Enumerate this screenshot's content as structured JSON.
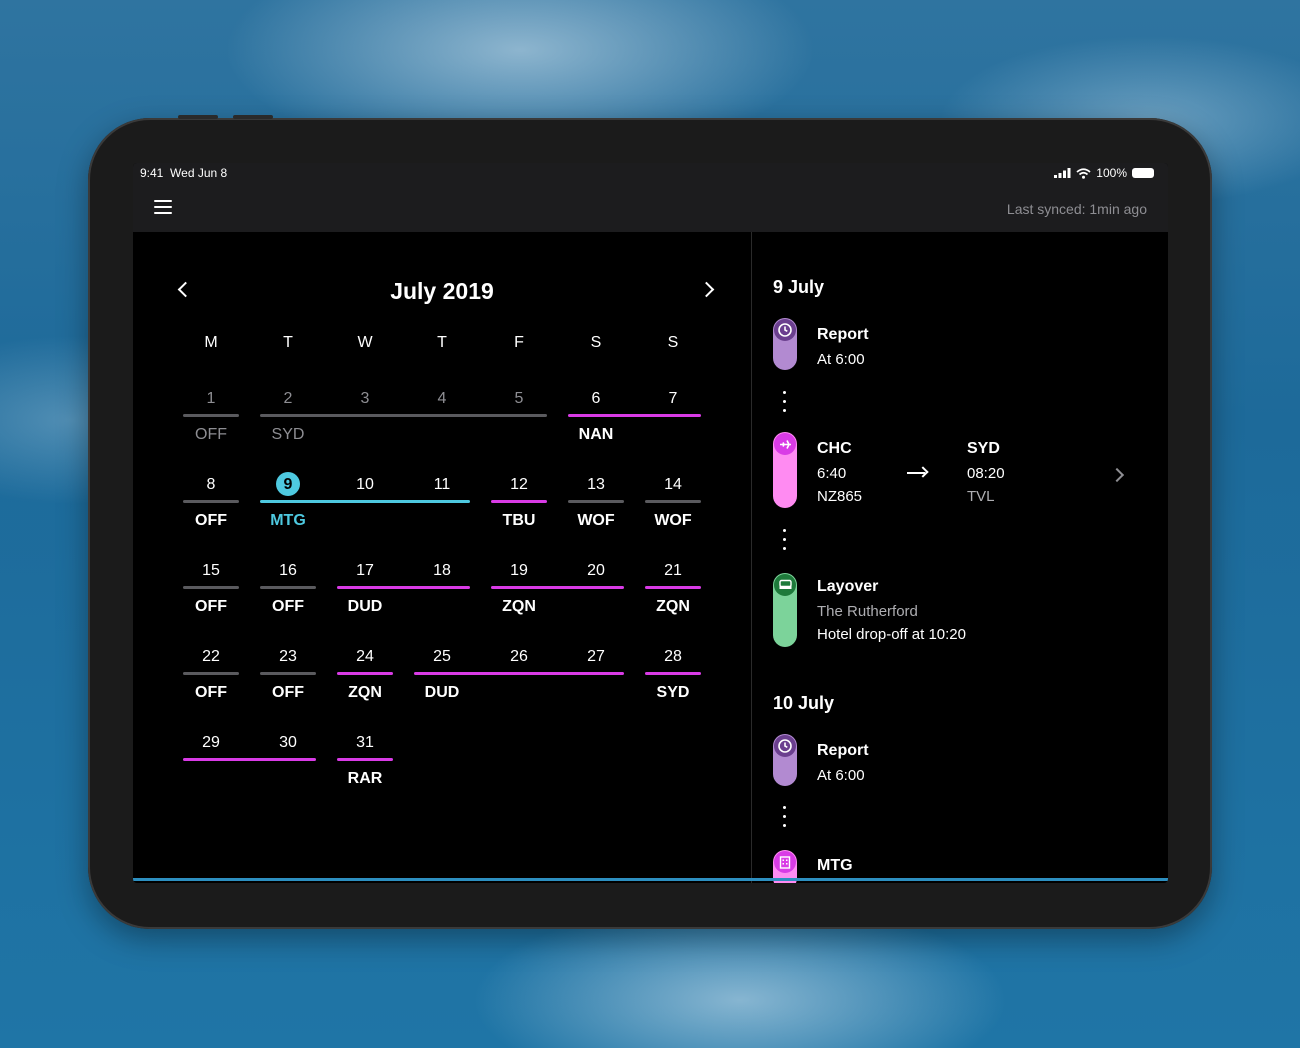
{
  "status_bar": {
    "time": "9:41",
    "date": "Wed Jun 8",
    "battery": "100%"
  },
  "app_bar": {
    "last_synced": "Last synced: 1min ago"
  },
  "colors": {
    "accent_purple": "#d93be6",
    "accent_cyan": "#4ec9e0",
    "neutral_bar": "#5a5a5e",
    "report": "#b28ad1",
    "flight": "#ff8bf2",
    "layover": "#7cd39a"
  },
  "calendar": {
    "month_title": "July 2019",
    "weekdays": [
      "M",
      "T",
      "W",
      "T",
      "F",
      "S",
      "S"
    ],
    "weeks": [
      {
        "days": [
          {
            "n": "1",
            "muted": true,
            "code": "OFF"
          },
          {
            "n": "2",
            "muted": true,
            "code": "SYD"
          },
          {
            "n": "3",
            "muted": true,
            "code": ""
          },
          {
            "n": "4",
            "muted": true,
            "code": ""
          },
          {
            "n": "5",
            "muted": true,
            "code": ""
          },
          {
            "n": "6",
            "code": "NAN"
          },
          {
            "n": "7",
            "code": ""
          }
        ],
        "bars": [
          {
            "from": 0,
            "to": 0,
            "color": "neutral_bar"
          },
          {
            "from": 1,
            "to": 4,
            "color": "neutral_bar"
          },
          {
            "from": 5,
            "to": 6,
            "color": "accent_purple"
          }
        ]
      },
      {
        "days": [
          {
            "n": "8",
            "code": "OFF"
          },
          {
            "n": "9",
            "code": "MTG",
            "today": true
          },
          {
            "n": "10",
            "code": ""
          },
          {
            "n": "11",
            "code": ""
          },
          {
            "n": "12",
            "code": "TBU"
          },
          {
            "n": "13",
            "code": "WOF"
          },
          {
            "n": "14",
            "code": "WOF"
          }
        ],
        "bars": [
          {
            "from": 0,
            "to": 0,
            "color": "neutral_bar"
          },
          {
            "from": 1,
            "to": 3,
            "color": "accent_cyan"
          },
          {
            "from": 4,
            "to": 4,
            "color": "accent_purple"
          },
          {
            "from": 5,
            "to": 5,
            "color": "neutral_bar"
          },
          {
            "from": 6,
            "to": 6,
            "color": "neutral_bar"
          }
        ]
      },
      {
        "days": [
          {
            "n": "15",
            "code": "OFF"
          },
          {
            "n": "16",
            "code": "OFF"
          },
          {
            "n": "17",
            "code": "DUD"
          },
          {
            "n": "18",
            "code": ""
          },
          {
            "n": "19",
            "code": "ZQN"
          },
          {
            "n": "20",
            "code": ""
          },
          {
            "n": "21",
            "code": "ZQN"
          }
        ],
        "bars": [
          {
            "from": 0,
            "to": 0,
            "color": "neutral_bar"
          },
          {
            "from": 1,
            "to": 1,
            "color": "neutral_bar"
          },
          {
            "from": 2,
            "to": 3,
            "color": "accent_purple"
          },
          {
            "from": 4,
            "to": 5,
            "color": "accent_purple"
          },
          {
            "from": 6,
            "to": 6,
            "color": "accent_purple"
          }
        ]
      },
      {
        "days": [
          {
            "n": "22",
            "code": "OFF"
          },
          {
            "n": "23",
            "code": "OFF"
          },
          {
            "n": "24",
            "code": "ZQN"
          },
          {
            "n": "25",
            "code": "DUD"
          },
          {
            "n": "26",
            "code": ""
          },
          {
            "n": "27",
            "code": ""
          },
          {
            "n": "28",
            "code": "SYD"
          }
        ],
        "bars": [
          {
            "from": 0,
            "to": 0,
            "color": "neutral_bar"
          },
          {
            "from": 1,
            "to": 1,
            "color": "neutral_bar"
          },
          {
            "from": 2,
            "to": 2,
            "color": "accent_purple"
          },
          {
            "from": 3,
            "to": 5,
            "color": "accent_purple"
          },
          {
            "from": 6,
            "to": 6,
            "color": "accent_purple"
          }
        ]
      },
      {
        "days": [
          {
            "n": "29",
            "code": ""
          },
          {
            "n": "30",
            "code": ""
          },
          {
            "n": "31",
            "code": "RAR"
          }
        ],
        "bars": [
          {
            "from": 0,
            "to": 1,
            "color": "accent_purple"
          },
          {
            "from": 2,
            "to": 2,
            "color": "accent_purple"
          }
        ]
      }
    ]
  },
  "detail": {
    "day1": {
      "date": "9 July",
      "report": {
        "title": "Report",
        "sub": "At 6:00",
        "icon": "clock-icon"
      },
      "flight": {
        "icon": "plane-icon",
        "from": "CHC",
        "dep_time": "6:40",
        "flight_no": "NZ865",
        "to": "SYD",
        "arr_time": "08:20",
        "aircraft": "TVL"
      },
      "layover": {
        "title": "Layover",
        "hotel": "The Rutherford",
        "note": "Hotel drop-off at 10:20",
        "icon": "bed-icon"
      }
    },
    "day2": {
      "date": "10 July",
      "report": {
        "title": "Report",
        "sub": "At 6:00",
        "icon": "clock-icon"
      },
      "meeting": {
        "title": "MTG",
        "icon": "building-icon"
      }
    }
  }
}
